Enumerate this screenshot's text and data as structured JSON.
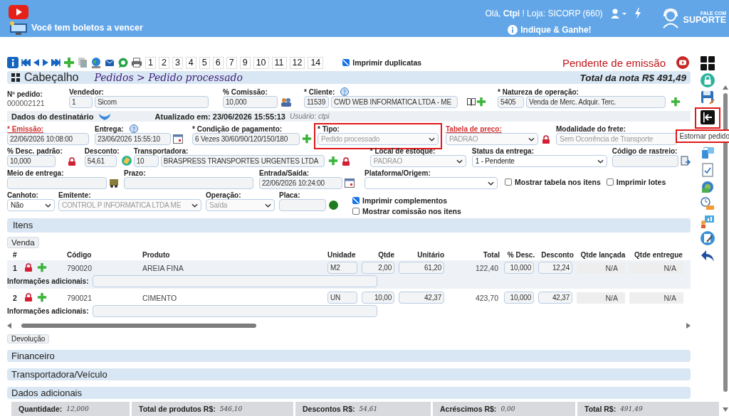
{
  "header": {
    "notice": "Você tem boletos a vencer",
    "greeting": "Olá, **Ctpi** ! Loja: SICORP (660)",
    "referral": "Indique & Ganhe!",
    "support_top": "FALE COM",
    "support_bottom": "SUPORTE"
  },
  "toolbar": {
    "pages": [
      "1",
      "2",
      "3",
      "4",
      "5",
      "6",
      "7",
      "9",
      "10",
      "11",
      "12",
      "14"
    ],
    "print_duplicates": {
      "label": "Imprimir duplicatas",
      "checked": true
    },
    "status": "Pendente de emissão"
  },
  "section": {
    "title": "Cabeçalho",
    "breadcrumb": "Pedidos > Pedido processado",
    "total": "Total da nota R$ 491,49"
  },
  "order_number": {
    "label": "Nº pedido:",
    "value": "000002121"
  },
  "seller": {
    "label": "Vendedor:",
    "code": "1",
    "name": "Sicom"
  },
  "commission": {
    "label": "% Comissão:",
    "value": "10,000"
  },
  "client": {
    "label": "* Cliente:",
    "code": "11539",
    "name": "CWD WEB INFORMATICA LTDA - ME"
  },
  "operation_nature": {
    "label": "* Natureza de operação:",
    "code": "5405",
    "name": "Venda de Merc. Adquir. Terc."
  },
  "recipient_bar": {
    "label": "Dados do destinatário",
    "expanded": false,
    "updated": "Atualizado em: 23/06/2026 15:55:13",
    "user": "Usuário: ctpi"
  },
  "issue_date": {
    "label": "* Emissão:",
    "value": "22/06/2026 10:08:00",
    "link": true
  },
  "delivery_date": {
    "label": "Entrega:",
    "value": "23/06/2026 15:55:10"
  },
  "payment_terms": {
    "label": "* Condição de pagamento:",
    "value": "6 Vezes 30/60/90/120/150/180"
  },
  "type": {
    "label": "* Tipo:",
    "value": "Pedido processado",
    "disabled": true,
    "highlighted": true
  },
  "price_table": {
    "label": "Tabela de preço:",
    "value": "PADRAO",
    "disabled": true,
    "link": true
  },
  "freight_mode": {
    "label": "Modalidade do frete:",
    "value": "Sem Ocorrência de Transporte",
    "disabled": true
  },
  "default_discount": {
    "label": "% Desc. padrão:",
    "value": "10,000"
  },
  "discount": {
    "label": "Desconto:",
    "value": "54,61"
  },
  "carrier": {
    "label": "Transportadora:",
    "code": "10",
    "name": "BRASPRESS TRANSPORTES URGENTES LTDA"
  },
  "stock_location": {
    "label": "* Local de estoque:",
    "value": "PADRAO",
    "disabled": true
  },
  "delivery_status": {
    "label": "Status da entrega:",
    "value": "1 - Pendente",
    "disabled": false
  },
  "tracking_code": {
    "label": "Código de rastreio:"
  },
  "delivery_method": {
    "label": "Meio de entrega:"
  },
  "deadline": {
    "label": "Prazo:"
  },
  "entry_exit": {
    "label": "Entrada/Saída:",
    "value": "22/06/2026 10:24:00"
  },
  "platform": {
    "label": "Plataforma/Origem:"
  },
  "show_price_table": {
    "label": "Mostrar tabela nos itens",
    "checked": false
  },
  "print_lots": {
    "label": "Imprimir lotes",
    "checked": false
  },
  "stub": {
    "label": "Canhoto:",
    "value": "Não",
    "disabled": false
  },
  "issuer": {
    "label": "Emitente:",
    "value": "CONTROL P INFORMATICA LTDA ME",
    "disabled": true
  },
  "operation": {
    "label": "Operação:",
    "value": "Saída",
    "disabled": true
  },
  "plate": {
    "label": "Placa:"
  },
  "print_complements": {
    "label": "Imprimir complementos",
    "checked": true
  },
  "show_commission": {
    "label": "Mostrar comissão nos itens",
    "checked": false
  },
  "reverse_button": {
    "tooltip": "Estornar pedido",
    "highlighted": true
  },
  "items": {
    "title": "Itens",
    "tab": "Venda",
    "columns": [
      "#",
      "Código",
      "Produto",
      "Unidade",
      "Qtde",
      "Unitário",
      "Total",
      "% Desc.",
      "Desconto",
      "Qtde lançada",
      "Qtde entregue"
    ],
    "rows": [
      {
        "number": "1",
        "code": "790020",
        "product": "AREIA FINA",
        "unit": "M2",
        "qty": "2,00",
        "price": "61,20",
        "total": "122,40",
        "discount_pct": "10,000",
        "discount": "12,24",
        "launched": "N/A",
        "delivered": "N/A",
        "info_label": "Informações adicionais:",
        "selected": true
      },
      {
        "number": "2",
        "code": "790021",
        "product": "CIMENTO",
        "unit": "UN",
        "qty": "10,00",
        "price": "42,37",
        "total": "423,70",
        "discount_pct": "10,000",
        "discount": "42,37",
        "launched": "N/A",
        "delivered": "N/A",
        "info_label": "Informações adicionais:",
        "selected": false
      }
    ]
  },
  "return_button": "Devolução",
  "sections": [
    "Financeiro",
    "Transportadora/Veículo",
    "Dados adicionais"
  ],
  "totals": [
    {
      "label": "Quantidade:",
      "value": "12,000"
    },
    {
      "label": "Total de produtos R$:",
      "value": "546,10"
    },
    {
      "label": "Descontos R$:",
      "value": "54,61"
    },
    {
      "label": "Acréscimos R$:",
      "value": "0,00"
    },
    {
      "label": "Total R$:",
      "value": "491,49"
    }
  ]
}
